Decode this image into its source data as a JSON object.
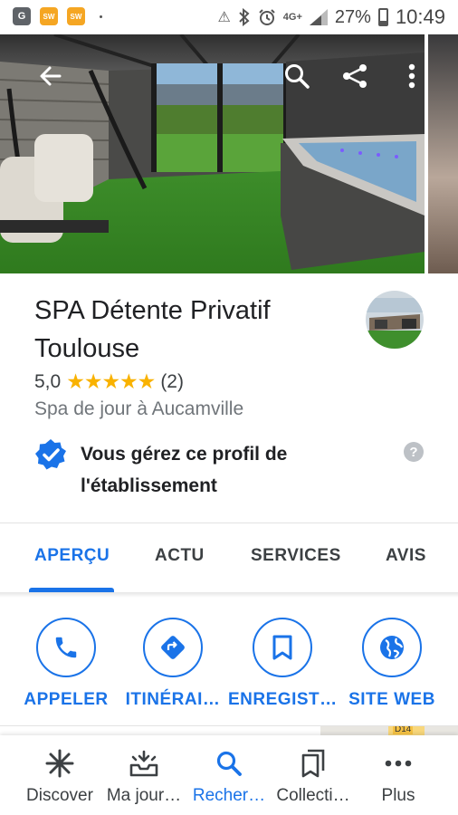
{
  "status_bar": {
    "network": "4G+",
    "battery": "27%",
    "time": "10:49",
    "app_icons": [
      "G",
      "SW",
      "SW"
    ]
  },
  "hero": {
    "actions": [
      "back-arrow-icon",
      "search-icon",
      "share-icon",
      "more-vert-icon"
    ]
  },
  "place": {
    "name": "SPA Détente Privatif Toulouse",
    "rating": "5,0",
    "stars": "★★★★★",
    "review_count": "(2)",
    "category": "Spa de jour à Aucamville",
    "verified_text": "Vous gérez ce profil de l'établissement",
    "help": "?"
  },
  "tabs": [
    {
      "label": "APERÇU",
      "active": true
    },
    {
      "label": "ACTU",
      "active": false
    },
    {
      "label": "SERVICES",
      "active": false
    },
    {
      "label": "AVIS",
      "active": false
    }
  ],
  "actions": [
    {
      "label": "APPELER",
      "icon": "phone-icon"
    },
    {
      "label": "ITINÉRAI…",
      "icon": "directions-icon"
    },
    {
      "label": "ENREGIST…",
      "icon": "bookmark-icon"
    },
    {
      "label": "SITE WEB",
      "icon": "globe-icon"
    }
  ],
  "map": {
    "road_label": "D14"
  },
  "bottom_nav": [
    {
      "label": "Discover",
      "icon": "asterisk-icon",
      "active": false
    },
    {
      "label": "Ma jour…",
      "icon": "tray-icon",
      "active": false
    },
    {
      "label": "Recher…",
      "icon": "search-icon",
      "active": true
    },
    {
      "label": "Collecti…",
      "icon": "collections-icon",
      "active": false
    },
    {
      "label": "Plus",
      "icon": "more-horiz-icon",
      "active": false
    }
  ],
  "colors": {
    "accent": "#1a73e8",
    "star": "#f9b200",
    "verified": "#1a73e8"
  }
}
